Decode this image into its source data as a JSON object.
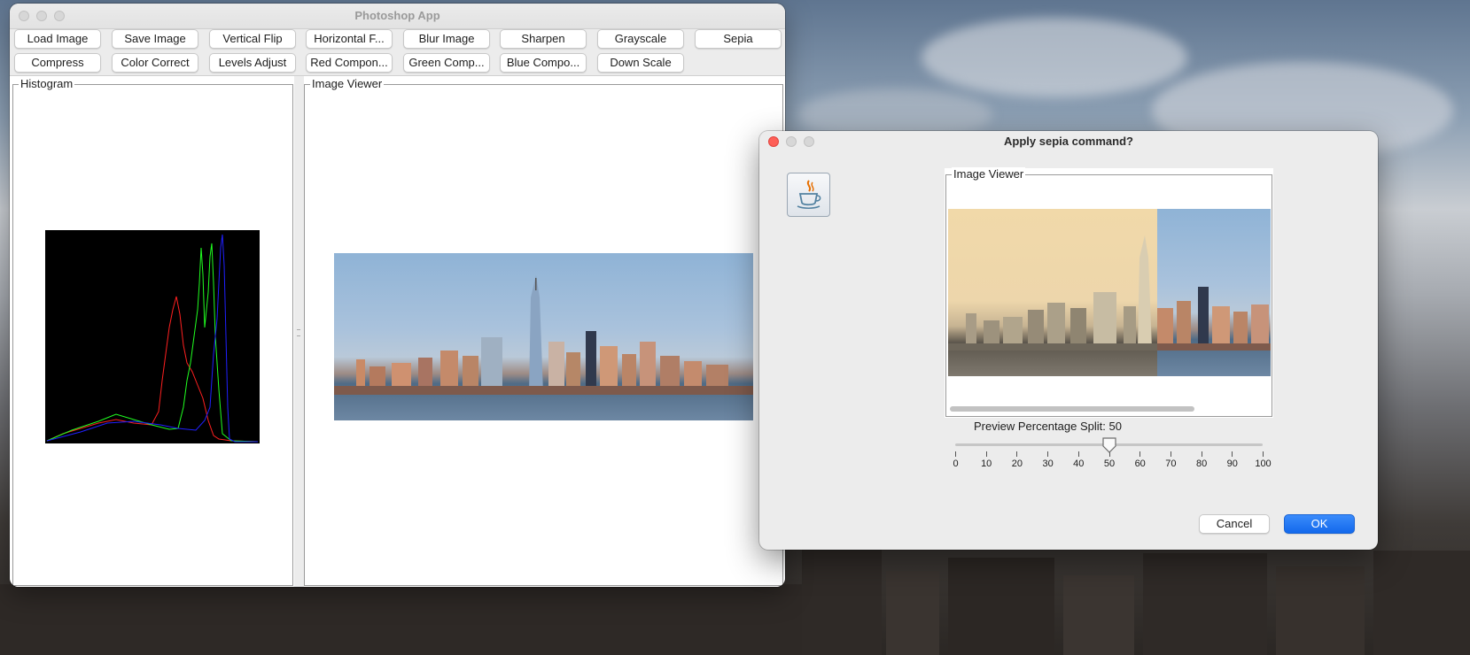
{
  "main_window": {
    "title": "Photoshop App",
    "toolbar_row1": [
      "Load Image",
      "Save Image",
      "Vertical Flip",
      "Horizontal F...",
      "Blur Image",
      "Sharpen",
      "Grayscale",
      "Sepia"
    ],
    "toolbar_row2": [
      "Compress",
      "Color Correct",
      "Levels Adjust",
      "Red Compon...",
      "Green Comp...",
      "Blue Compo...",
      "Down Scale"
    ],
    "histogram_panel": {
      "title": "Histogram"
    },
    "image_viewer_panel": {
      "title": "Image Viewer"
    }
  },
  "dialog": {
    "title": "Apply sepia command?",
    "icon": "java-cup-icon",
    "viewer_title": "Image Viewer",
    "slider_label": "Preview Percentage Split: 50",
    "slider_value": 50,
    "slider_ticks": [
      "0",
      "10",
      "20",
      "30",
      "40",
      "50",
      "60",
      "70",
      "80",
      "90",
      "100"
    ],
    "cancel_label": "Cancel",
    "ok_label": "OK"
  },
  "colors": {
    "ok_button": "#1369ec",
    "histogram_bg": "#000000",
    "red_channel": "#ff2020",
    "green_channel": "#20ff20",
    "blue_channel": "#2020ff"
  }
}
